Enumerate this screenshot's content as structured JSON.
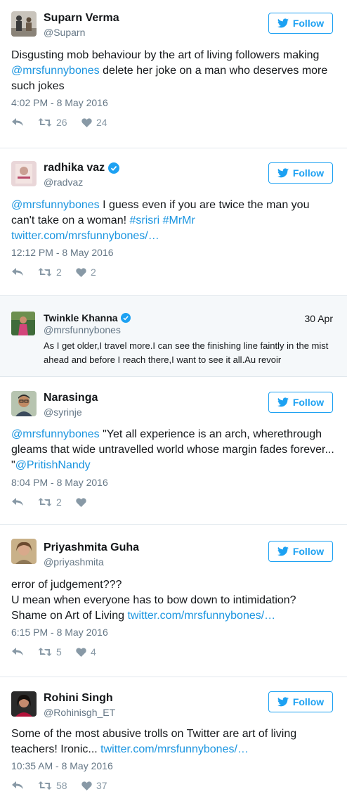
{
  "follow_label": "Follow",
  "tweets": [
    {
      "name": "Suparn Verma",
      "handle": "@Suparn",
      "text_parts": [
        "Disgusting mob behaviour by the art of living followers making ",
        "@mrsfunnybones",
        " delete her joke on a man who deserves more such jokes"
      ],
      "timestamp": "4:02 PM - 8 May 2016",
      "retweets": "26",
      "likes": "24"
    },
    {
      "name": "radhika vaz",
      "handle": "@radvaz",
      "verified": true,
      "text_parts": [
        "@mrsfunnybones",
        " I guess even if you are twice the man you can't take on a woman! ",
        "#srisri",
        " ",
        "#MrMr",
        "twitter.com/mrsfunnybones/…"
      ],
      "timestamp": "12:12 PM - 8 May 2016",
      "retweets": "2",
      "likes": "2"
    },
    {
      "name": "Narasinga",
      "handle": "@syrinje",
      "text_parts": [
        "@mrsfunnybones",
        " \"Yet all experience is an arch, wherethrough gleams that wide untravelled world whose margin fades forever... \"",
        "@PritishNandy"
      ],
      "timestamp": "8:04 PM - 8 May 2016",
      "retweets": "2",
      "likes": ""
    },
    {
      "name": "Priyashmita Guha",
      "handle": "@priyashmita",
      "text_parts": [
        "error of judgement???",
        "U mean when everyone has to bow down to intimidation?",
        "Shame on Art of Living ",
        "twitter.com/mrsfunnybones/…"
      ],
      "timestamp": "6:15 PM - 8 May 2016",
      "retweets": "5",
      "likes": "4"
    },
    {
      "name": "Rohini Singh",
      "handle": "@Rohinisgh_ET",
      "text_parts": [
        "Some of the most abusive trolls on Twitter are art of living teachers! Ironic... ",
        "twitter.com/mrsfunnybones/…"
      ],
      "timestamp": "10:35 AM - 8 May 2016",
      "retweets": "58",
      "likes": "37"
    }
  ],
  "quoted": {
    "name": "Twinkle Khanna",
    "handle": "@mrsfunnybones",
    "verified": true,
    "date": "30 Apr",
    "text": "As I get older,I travel more.I can see the finishing line faintly in the mist ahead and before I reach there,I want to see it all.Au revoir"
  },
  "colors": {
    "accent": "#1da1f2",
    "link": "#1b95e0",
    "muted": "#657786",
    "icon": "#8899a6",
    "divider": "#e1e8ed",
    "quoted_bg": "#f5f8fa"
  },
  "icons": [
    "reply-icon",
    "retweet-icon",
    "heart-icon",
    "twitter-bird-icon",
    "verified-badge-icon"
  ]
}
